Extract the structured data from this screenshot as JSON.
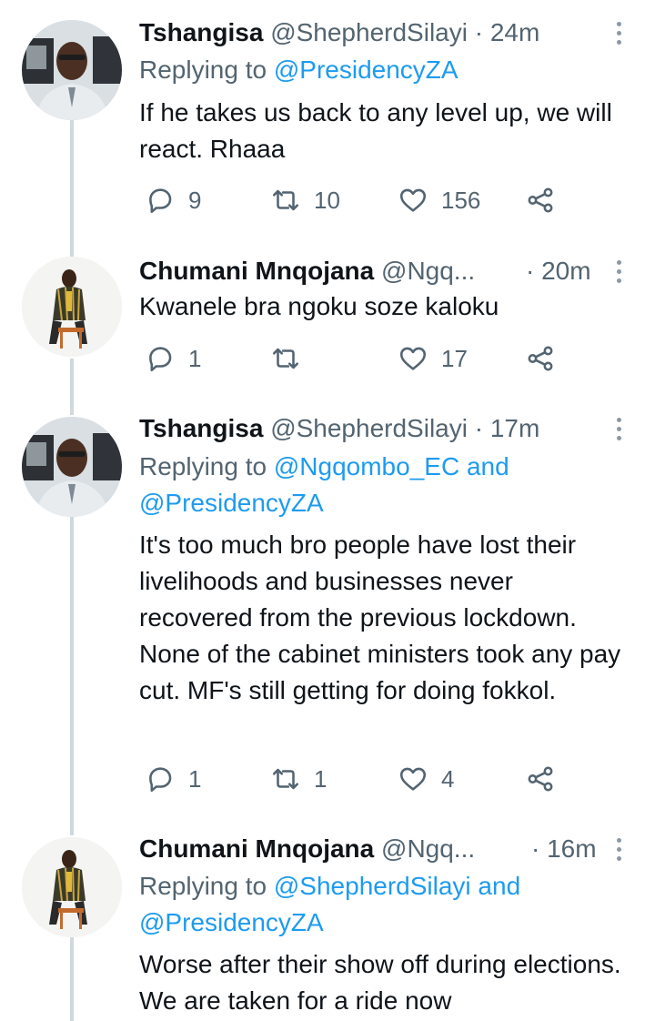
{
  "tweets": [
    {
      "name": "Tshangisa",
      "handle": "@ShepherdSilayi",
      "time": "24m",
      "reply_prefix": "Replying to",
      "reply_line1": "@PresidencyZA",
      "reply_line2": "",
      "text": "If he takes us back to any level up, we will react. Rhaaa",
      "replies": "9",
      "retweets": "10",
      "likes": "156",
      "avatar_icon": "man-in-car-avatar"
    },
    {
      "name": "Chumani Mnqojana",
      "handle": "@Ngq...",
      "time": "20m",
      "reply_prefix": "",
      "reply_line1": "",
      "reply_line2": "",
      "text": "Kwanele bra ngoku soze kaloku",
      "replies": "1",
      "retweets": "",
      "likes": "17",
      "avatar_icon": "seated-man-avatar"
    },
    {
      "name": "Tshangisa",
      "handle": "@ShepherdSilayi",
      "time": "17m",
      "reply_prefix": "Replying to",
      "reply_line1": "@Ngqombo_EC and",
      "reply_line2": "@PresidencyZA",
      "text": "It's too much bro people have lost their livelihoods and businesses never recovered from the previous lockdown. None of the cabinet ministers took any pay cut. MF's still getting for doing fokkol.",
      "replies": "1",
      "retweets": "1",
      "likes": "4",
      "avatar_icon": "man-in-car-avatar"
    },
    {
      "name": "Chumani Mnqojana",
      "handle": "@Ngq...",
      "time": "16m",
      "reply_prefix": "Replying to",
      "reply_line1": "@ShepherdSilayi and",
      "reply_line2": "@PresidencyZA",
      "text": "Worse after their show off during elections. We are taken for a ride now",
      "replies": "",
      "retweets": "",
      "likes": "",
      "avatar_icon": "seated-man-avatar"
    }
  ],
  "separator": "·",
  "colors": {
    "accent": "#1d9bf0",
    "muted": "#536471",
    "thread_line": "#cfd9de"
  }
}
